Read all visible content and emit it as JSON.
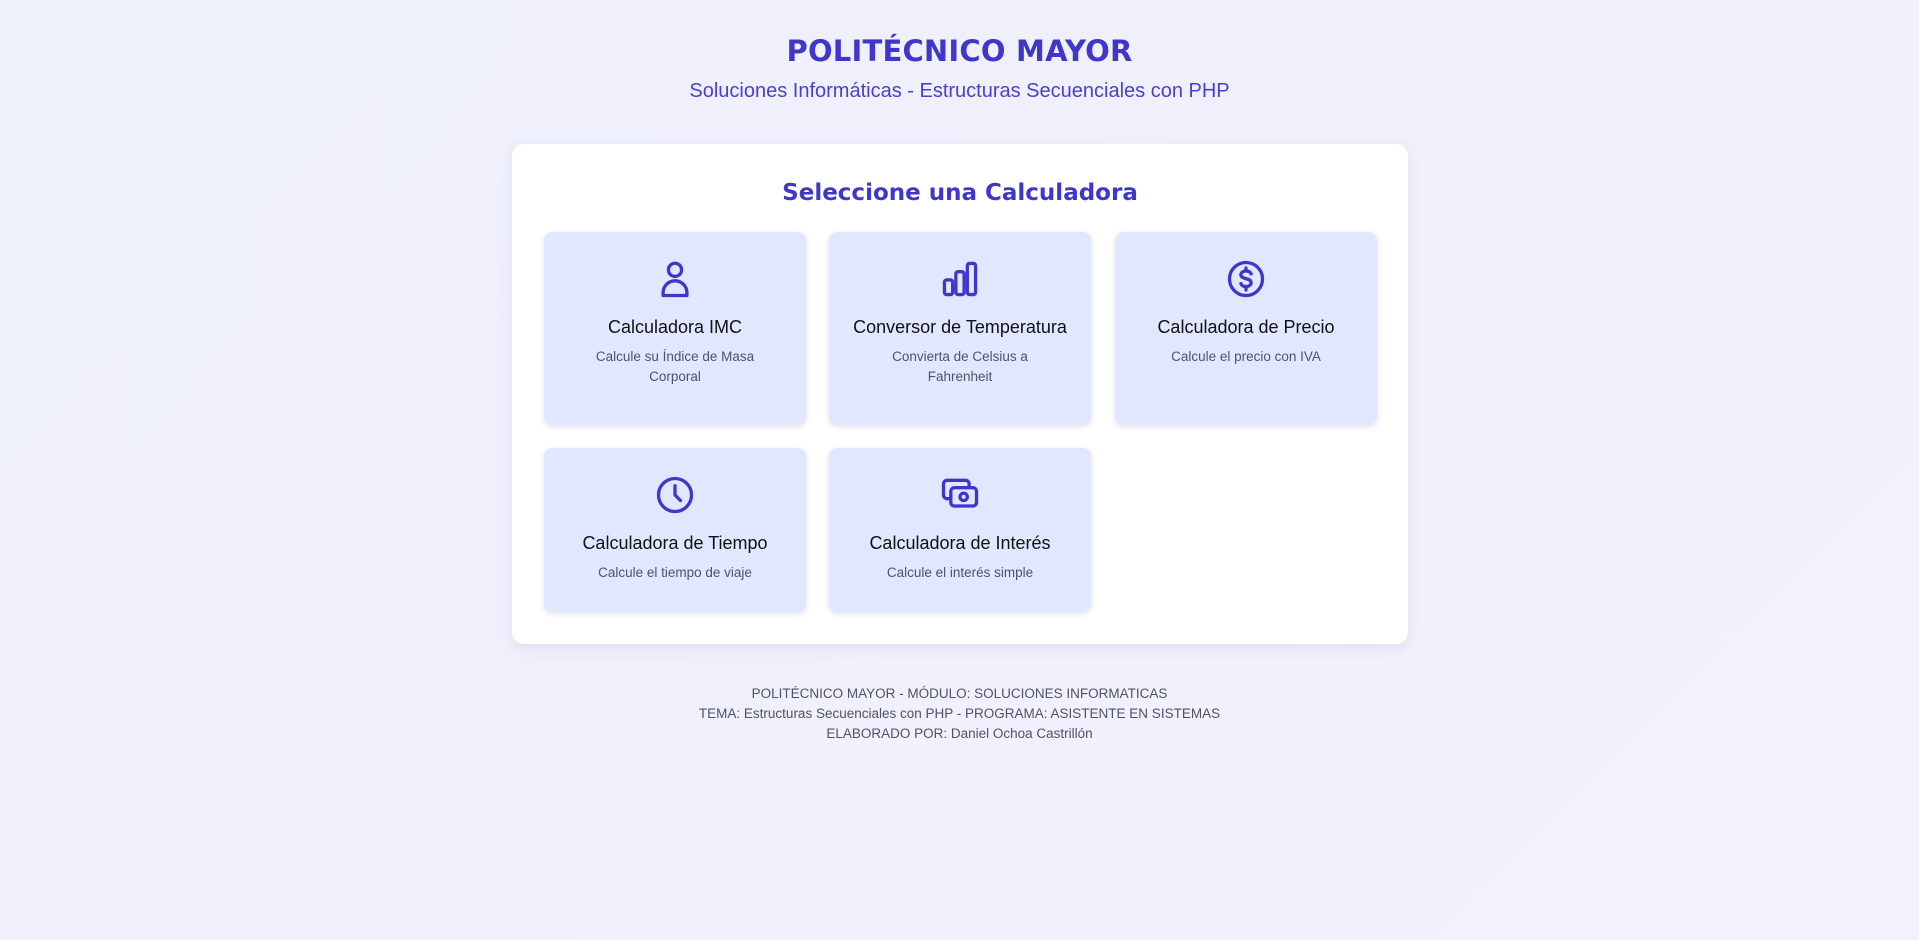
{
  "header": {
    "title": "POLITÉCNICO MAYOR",
    "subtitle": "Soluciones Informáticas - Estructuras Secuenciales con PHP"
  },
  "panel": {
    "heading": "Seleccione una Calculadora",
    "cards": [
      {
        "icon": "user-icon",
        "title": "Calculadora IMC",
        "description": "Calcule su Índice de Masa Corporal"
      },
      {
        "icon": "bar-chart-icon",
        "title": "Conversor de Temperatura",
        "description": "Convierta de Celsius a Fahrenheit"
      },
      {
        "icon": "dollar-circle-icon",
        "title": "Calculadora de Precio",
        "description": "Calcule el precio con IVA"
      },
      {
        "icon": "clock-icon",
        "title": "Calculadora de Tiempo",
        "description": "Calcule el tiempo de viaje"
      },
      {
        "icon": "cash-icon",
        "title": "Calculadora de Interés",
        "description": "Calcule el interés simple"
      }
    ]
  },
  "footer": {
    "line1": "POLITÉCNICO MAYOR - MÓDULO: SOLUCIONES INFORMATICAS",
    "line2": "TEMA: Estructuras Secuenciales con PHP - PROGRAMA: ASISTENTE EN SISTEMAS",
    "line3": "ELABORADO POR: Daniel Ochoa Castrillón"
  },
  "colors": {
    "accent": "#3f37c9",
    "card_background": "#e0e7ff",
    "panel_background": "#ffffff"
  }
}
